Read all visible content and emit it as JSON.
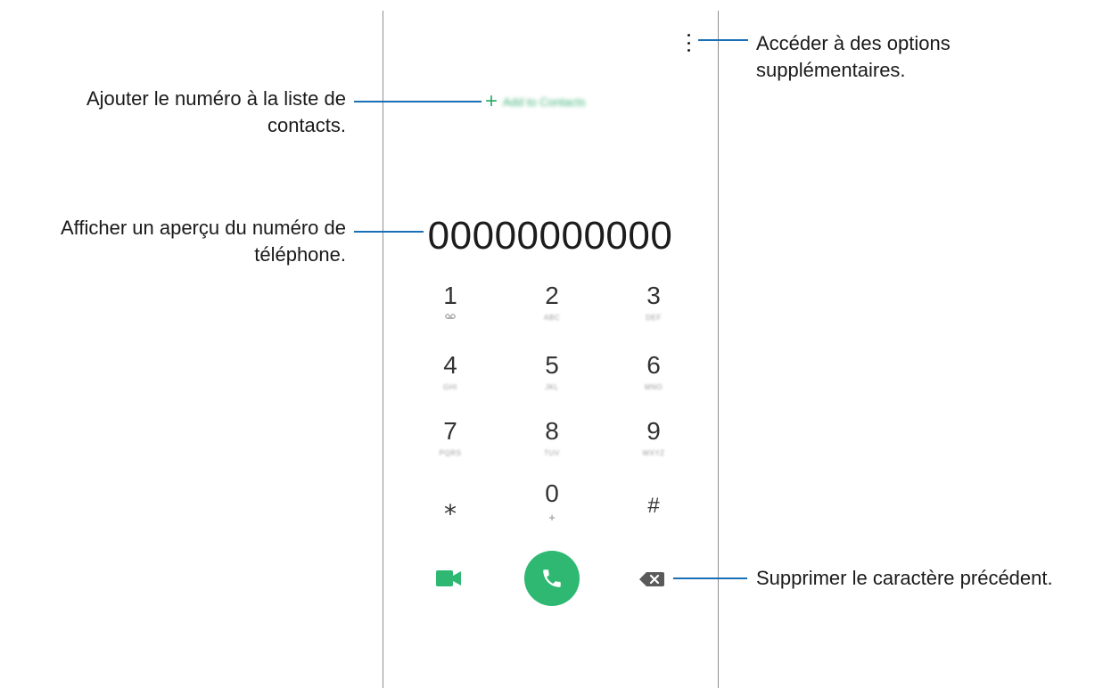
{
  "dialer": {
    "add_contacts": {
      "plus": "+",
      "label": "Add to Contacts"
    },
    "number": "00000000000",
    "keys": [
      {
        "digit": "1",
        "letters": ""
      },
      {
        "digit": "2",
        "letters": "ABC"
      },
      {
        "digit": "3",
        "letters": "DEF"
      },
      {
        "digit": "4",
        "letters": "GHI"
      },
      {
        "digit": "5",
        "letters": "JKL"
      },
      {
        "digit": "6",
        "letters": "MNO"
      },
      {
        "digit": "7",
        "letters": "PQRS"
      },
      {
        "digit": "8",
        "letters": "TUV"
      },
      {
        "digit": "9",
        "letters": "WXYZ"
      },
      {
        "digit": "⁎",
        "letters": ""
      },
      {
        "digit": "0",
        "letters": "+"
      },
      {
        "digit": "#",
        "letters": ""
      }
    ]
  },
  "callouts": {
    "more_options": "Accéder à des options supplémentaires.",
    "add_to_contacts": "Ajouter le numéro à la liste de contacts.",
    "preview_number": "Afficher un aperçu du numéro de téléphone.",
    "delete_char": "Supprimer le caractère précédent."
  },
  "icons": {
    "more_options": "more-vertical-icon",
    "voicemail": "voicemail-icon",
    "video_call": "video-call-icon",
    "call": "phone-icon",
    "backspace": "backspace-icon"
  },
  "colors": {
    "accent": "#2eb872",
    "callout_line": "#1a70b6"
  }
}
